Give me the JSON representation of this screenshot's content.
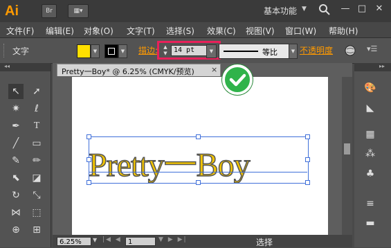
{
  "titlebar": {
    "app_logo": "Ai",
    "br_button": "Br",
    "workspace": "基本功能",
    "window_controls": [
      "—",
      "□",
      "✕"
    ]
  },
  "menu": [
    "文件(F)",
    "编辑(E)",
    "对象(O)",
    "文字(T)",
    "选择(S)",
    "效果(C)",
    "视图(V)",
    "窗口(W)",
    "帮助(H)"
  ],
  "control_bar": {
    "label": "文字",
    "fill_color": "#ffe000",
    "stroke_label": "描边:",
    "stroke_value": "14 pt",
    "profile_label": "等比",
    "opacity_label": "不透明度"
  },
  "document": {
    "tab_title": "Pretty一Boy* @ 6.25% (CMYK/预览)",
    "tab_close": "×",
    "artwork_text": "Pretty一Boy",
    "zoom": "6.25%",
    "page": "1",
    "status": "选择"
  },
  "colors": {
    "accent_orange": "#ff9a00",
    "highlight_red": "#e8205a",
    "check_green": "#2fb34a",
    "selection_blue": "#3f6fd9",
    "text_fill": "#f2c400"
  }
}
